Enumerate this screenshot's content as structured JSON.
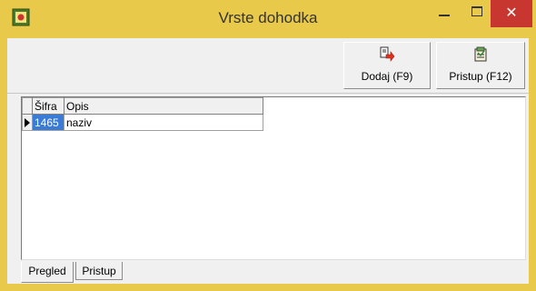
{
  "window": {
    "title": "Vrste dohodka",
    "close_glyph": "✕",
    "icon": "app-icon",
    "accent": "#e8c94a",
    "close_color": "#c7372f"
  },
  "toolbar": {
    "add_label": "Dodaj (F9)",
    "add_icon": "add-arrow-icon",
    "access_label": "Pristup (F12)",
    "access_icon": "access-icon"
  },
  "grid": {
    "columns": [
      "Šifra",
      "Opis"
    ],
    "rows": [
      {
        "sifra": "1465",
        "opis": "naziv"
      }
    ],
    "selection_color": "#3a7bd5"
  },
  "tabs": [
    {
      "label": "Pregled"
    },
    {
      "label": "Pristup"
    }
  ]
}
